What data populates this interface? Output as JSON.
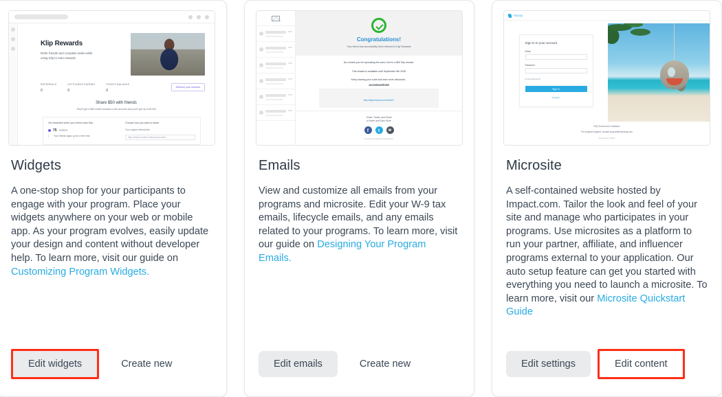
{
  "cards": [
    {
      "id": "widgets",
      "title": "Widgets",
      "description_pre": "A one-stop shop for your participants to engage with your program. Place your widgets anywhere on your web or mobile app. As your program evolves, easily update your design and content without developer help. To learn more, visit our guide on ",
      "link_text": "Customizing Program Widgets.",
      "description_post": "",
      "primary_button": "Edit widgets",
      "secondary_button": "Create new",
      "primary_highlighted": true,
      "secondary_highlighted": false,
      "primary_style": "grey",
      "thumbnail": {
        "type": "browser-widget-preview",
        "hero_title": "Klip Rewards",
        "hero_subtitle": "Refer friends and complete tasks while using Klip to earn rewards",
        "stats": [
          {
            "label": "REFERRALS",
            "value": "0"
          },
          {
            "label": "GIFTCARDS EARNED",
            "value": "0"
          },
          {
            "label": "POINTS BALANCE",
            "value": "0"
          }
        ],
        "redeem_button": "Redeem your rewards",
        "share_heading": "Share $50 with friends",
        "share_sub": "They'll get a $50 credit towards a new account and you'll get up to $1200",
        "panel_left_heading": "Get rewarded when your friend uses Klip",
        "panel_step_number": "75",
        "panel_step_unit": "POINTS",
        "panel_step_desc": "Your friends signs up for a free trial",
        "panel_right_heading": "Choose how you want to share",
        "panel_right_label": "Your unique referral link",
        "panel_right_value": "https://klipcom.share.referral.yourcode/"
      }
    },
    {
      "id": "emails",
      "title": "Emails",
      "description_pre": "View and customize all emails from your programs and microsite. Edit your W-9 tax emails, lifecycle emails, and any emails related to your programs. To learn more, visit our guide on ",
      "link_text": "Designing Your Program Emails.",
      "description_post": "",
      "primary_button": "Edit emails",
      "secondary_button": "Create new",
      "primary_highlighted": false,
      "secondary_highlighted": false,
      "primary_style": "grey",
      "thumbnail": {
        "type": "email-preview",
        "inbox_items": 6,
        "headline": "Congratulations!",
        "subhead": "Your friend has successfully been referred to Klip Rewards",
        "body_1": "As a thank you for spreading the word, here's a $50 Klip reward.",
        "body_2": "This reward is available until September 8th 2030",
        "body_3": "Keep sharing your code and earn more discounts -",
        "promo_code": "JACKBAKER360",
        "link": "http://klipreward.com/ms2WI7",
        "share_line_1": "Share, Tweet, and Email",
        "share_line_2": "to Refer and Earn More",
        "socials": [
          "facebook-icon",
          "twitter-icon",
          "email-icon"
        ],
        "powered_by": "Powered by Referral Saasquatch"
      }
    },
    {
      "id": "microsite",
      "title": "Microsite",
      "description_pre": "A self-contained website hosted by Impact.com. Tailor the look and feel of your site and manage who participates in your programs. Use microsites as a platform to run your partner, affiliate, and influencer programs external to your application. Our auto setup feature can get you started with everything you need to launch a microsite. To learn more, visit our ",
      "link_text": "Microsite Quickstart Guide",
      "description_post": "",
      "primary_button": "Edit settings",
      "secondary_button": "Edit content",
      "primary_highlighted": false,
      "secondary_highlighted": true,
      "primary_style": "grey",
      "thumbnail": {
        "type": "microsite-preview",
        "brand": "Vacay",
        "form_heading": "Sign in to your account",
        "email_label": "Email",
        "password_label": "Password",
        "forgot_link": "Forgot Password?",
        "signin_button": "Sign In",
        "register_link": "Register",
        "footer_links": "FAQ    Terms And Conditions",
        "footer_support": "For program support, contact support@myvacay.com",
        "footer_powered": "Powered by  impact"
      }
    }
  ],
  "colors": {
    "link": "#29abe2",
    "highlight": "#ff2d16",
    "text": "#3b4754",
    "button_grey": "#e9ebed"
  }
}
